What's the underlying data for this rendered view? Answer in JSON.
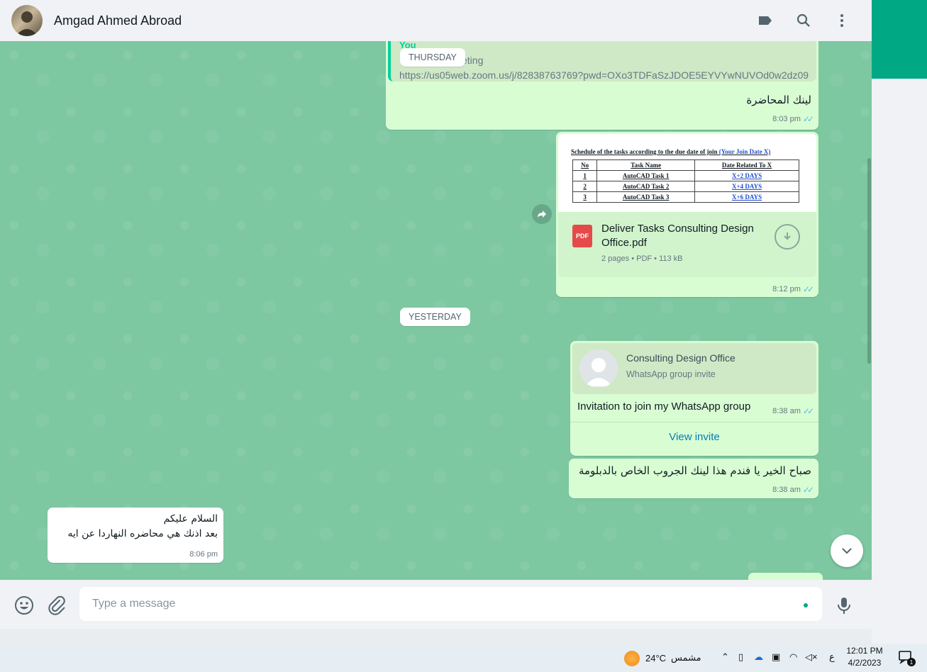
{
  "header": {
    "contact_name": "Amgad Ahmed Abroad"
  },
  "chat": {
    "dates": {
      "thursday": "THURSDAY",
      "yesterday": "YESTERDAY"
    },
    "msg1": {
      "quote_author": "You",
      "quote_title": "eting",
      "quote_link": "https://us05web.zoom.us/j/82838763769?pwd=OXo3TDFaSzJDOE5EYVYwNUVOd0w2dz09",
      "text": "لينك المحاضرة",
      "time": "8:03 pm"
    },
    "msg2": {
      "preview_title": "Schedule of the tasks according to the due date of join",
      "preview_title_link": "(Your Join Date   X)",
      "table_headers": [
        "No",
        "Task Name",
        "Date Related To X"
      ],
      "table_rows": [
        [
          "1",
          "AutoCAD Task 1",
          "X+2 DAYS"
        ],
        [
          "2",
          "AutoCAD Task 2",
          "X+4 DAYS"
        ],
        [
          "3",
          "AutoCAD Task 3",
          "X+6 DAYS"
        ]
      ],
      "pdf_badge": "PDF",
      "file_name": "Deliver Tasks Consulting Design Office.pdf",
      "file_meta": "2 pages • PDF • 113 kB",
      "time": "8:12 pm"
    },
    "msg3": {
      "group_name": "Consulting Design Office",
      "group_sub": "WhatsApp group invite",
      "text": "Invitation to join my WhatsApp group",
      "time": "8:38 am",
      "action": "View invite"
    },
    "msg4": {
      "text": "صباح الخير يا فندم هذا لينك الجروب الخاص بالدبلومة",
      "time": "8:38 am"
    },
    "msg5": {
      "line1": "السلام عليكم",
      "line2": "بعد اذنك هي محاضره النهاردا عن ايه",
      "time": "8:06 pm"
    }
  },
  "composer": {
    "placeholder": "Type a message"
  },
  "taskbar": {
    "weather_temp": "24°C",
    "weather_label": "مشمس",
    "lang": "ع",
    "time": "12:01 PM",
    "date": "4/2/2023",
    "notif_count": "1"
  },
  "colors": {
    "chat_bg": "#7dc7a1",
    "bubble_out": "#d9fdd3",
    "accent": "#00a884",
    "read_ticks": "#53bdeb"
  }
}
